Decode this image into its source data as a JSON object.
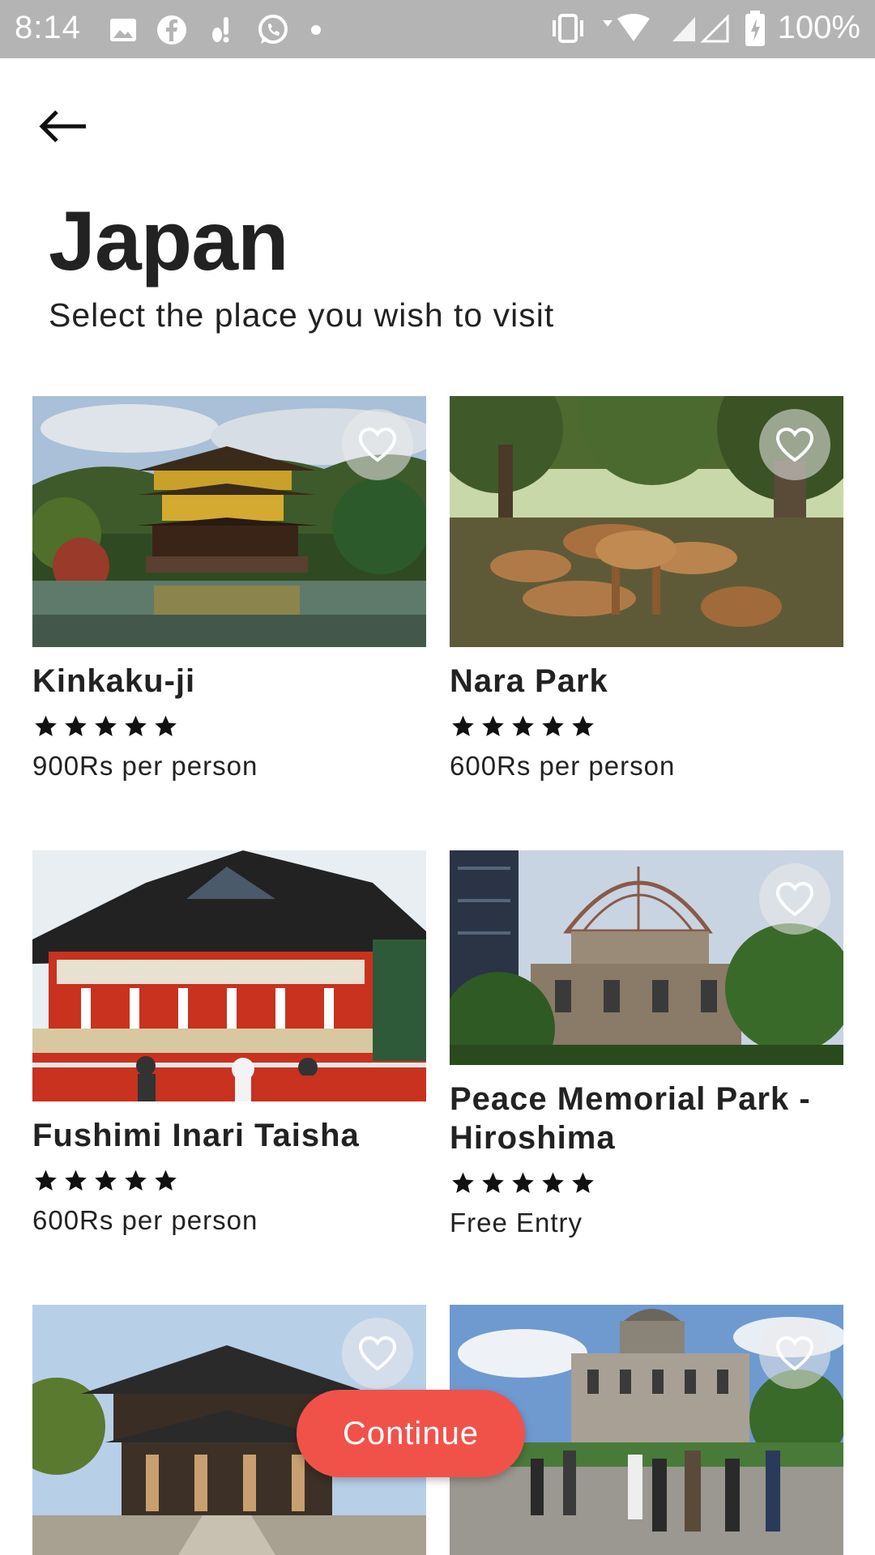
{
  "status_bar": {
    "time": "8:14",
    "battery": "100%",
    "left_icons": [
      "image-icon",
      "facebook-icon",
      "notification-icon",
      "whatsapp-icon",
      "dot-icon"
    ],
    "right_icons": [
      "vibrate-icon",
      "wifi-icon",
      "signal-icon",
      "battery-charging-icon"
    ]
  },
  "header": {
    "title": "Japan",
    "subtitle": "Select the place you wish to visit"
  },
  "places": [
    {
      "name": "Kinkaku-ji",
      "rating": 5,
      "price": "900Rs per person"
    },
    {
      "name": "Nara Park",
      "rating": 5,
      "price": "600Rs per person"
    },
    {
      "name": "Fushimi Inari Taisha",
      "rating": 5,
      "price": "600Rs per person"
    },
    {
      "name": "Peace Memorial Park - Hiroshima",
      "rating": 5,
      "price": "Free Entry"
    }
  ],
  "continue_label": "Continue",
  "colors": {
    "accent": "#f0524a",
    "status_bar": "#b4b4b4",
    "text": "#222222"
  }
}
